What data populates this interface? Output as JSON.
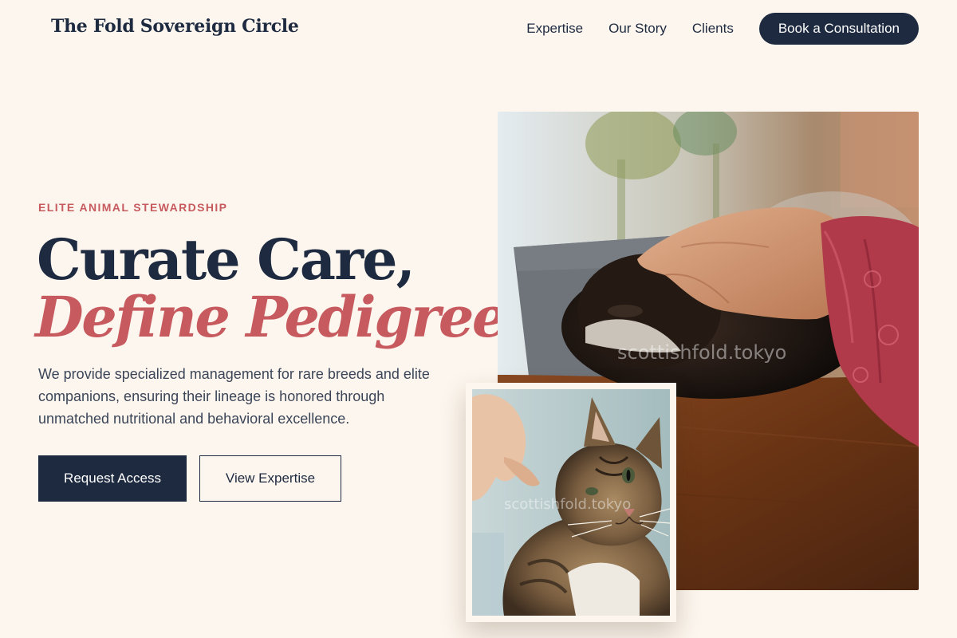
{
  "header": {
    "logo": "The Fold Sovereign Circle",
    "nav": [
      "Expertise",
      "Our Story",
      "Clients"
    ],
    "cta": "Book a Consultation"
  },
  "hero": {
    "eyebrow": "ELITE ANIMAL STEWARDSHIP",
    "headline_line1": "Curate Care,",
    "headline_line2": "Define Pedigree.",
    "lead": "We provide specialized management for rare breeds and elite companions, ensuring their lineage is honored through unmatched nutritional and behavioral excellence.",
    "primary_button": "Request Access",
    "secondary_button": "View Expertise"
  },
  "images": {
    "main_watermark": "scottishfold.tokyo",
    "inset_watermark": "scottishfold.tokyo"
  },
  "colors": {
    "background": "#fdf6ee",
    "navy": "#1e2a40",
    "accent": "#c75a5f"
  }
}
